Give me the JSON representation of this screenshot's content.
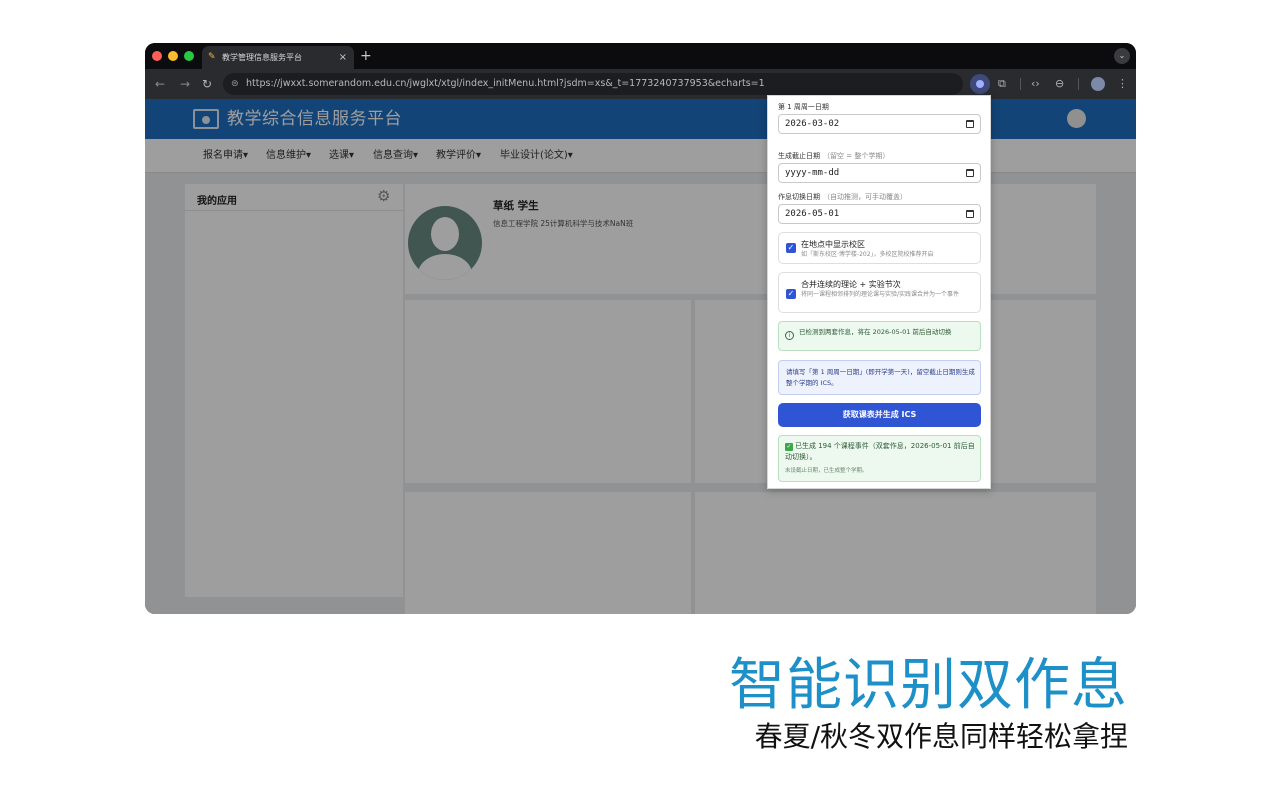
{
  "browser": {
    "tab_title": "教学管理信息服务平台",
    "tab_close": "×",
    "new_tab": "+",
    "url": "https://jwxxt.somerandom.edu.cn/jwglxt/xtgl/index_initMenu.html?jsdm=xs&_t=1773240737953&echarts=1"
  },
  "site": {
    "title": "教学综合信息服务平台",
    "menu": [
      "报名申请▾",
      "信息维护▾",
      "选课▾",
      "信息查询▾",
      "教学评价▾",
      "毕业设计(论文)▾"
    ],
    "my_apps_title": "我的应用",
    "student_name": "草纸  学生",
    "student_dept": "信息工程学院 25计算机科学与技术NaN班"
  },
  "popup": {
    "week1_label": "第 1 周周一日期",
    "week1_value": "2026-03-02",
    "end_label": "生成截止日期",
    "end_hint": "（留空 = 整个学期）",
    "end_placeholder": "yyyy-mm-dd",
    "switch_label": "作息切换日期",
    "switch_hint": "（自动推测，可手动覆盖）",
    "switch_value": "2026-05-01",
    "opt_campus_title": "在地点中显示校区",
    "opt_campus_sub": "如「斯东校区·博学楼-202」，多校区院校推荐开启",
    "opt_merge_title": "合并连续的理论 + 实验节次",
    "opt_merge_sub": "将同一课程相邻排列的理论课与实验/实践课合并为一个事件",
    "notice_detect": "已检测到两套作息，将在 2026-05-01 前后自动切换",
    "notice_fill": "请填写「第 1 周周一日期」(即开学第一天)，留空截止日期则生成整个学期的 ICS。",
    "button": "获取课表并生成 ICS",
    "result_main": "已生成 194 个课程事件（双套作息，2026-05-01 前后自动切换）。",
    "result_sub": "未设截止日期，已生成整个学期。"
  },
  "caption": {
    "headline": "智能识别双作息",
    "subline": "春夏/秋冬双作息同样轻松拿捏"
  },
  "colors": {
    "headline": "#1e90c8",
    "header_blue": "#1f6fc1",
    "primary_button": "#2f55d4"
  }
}
